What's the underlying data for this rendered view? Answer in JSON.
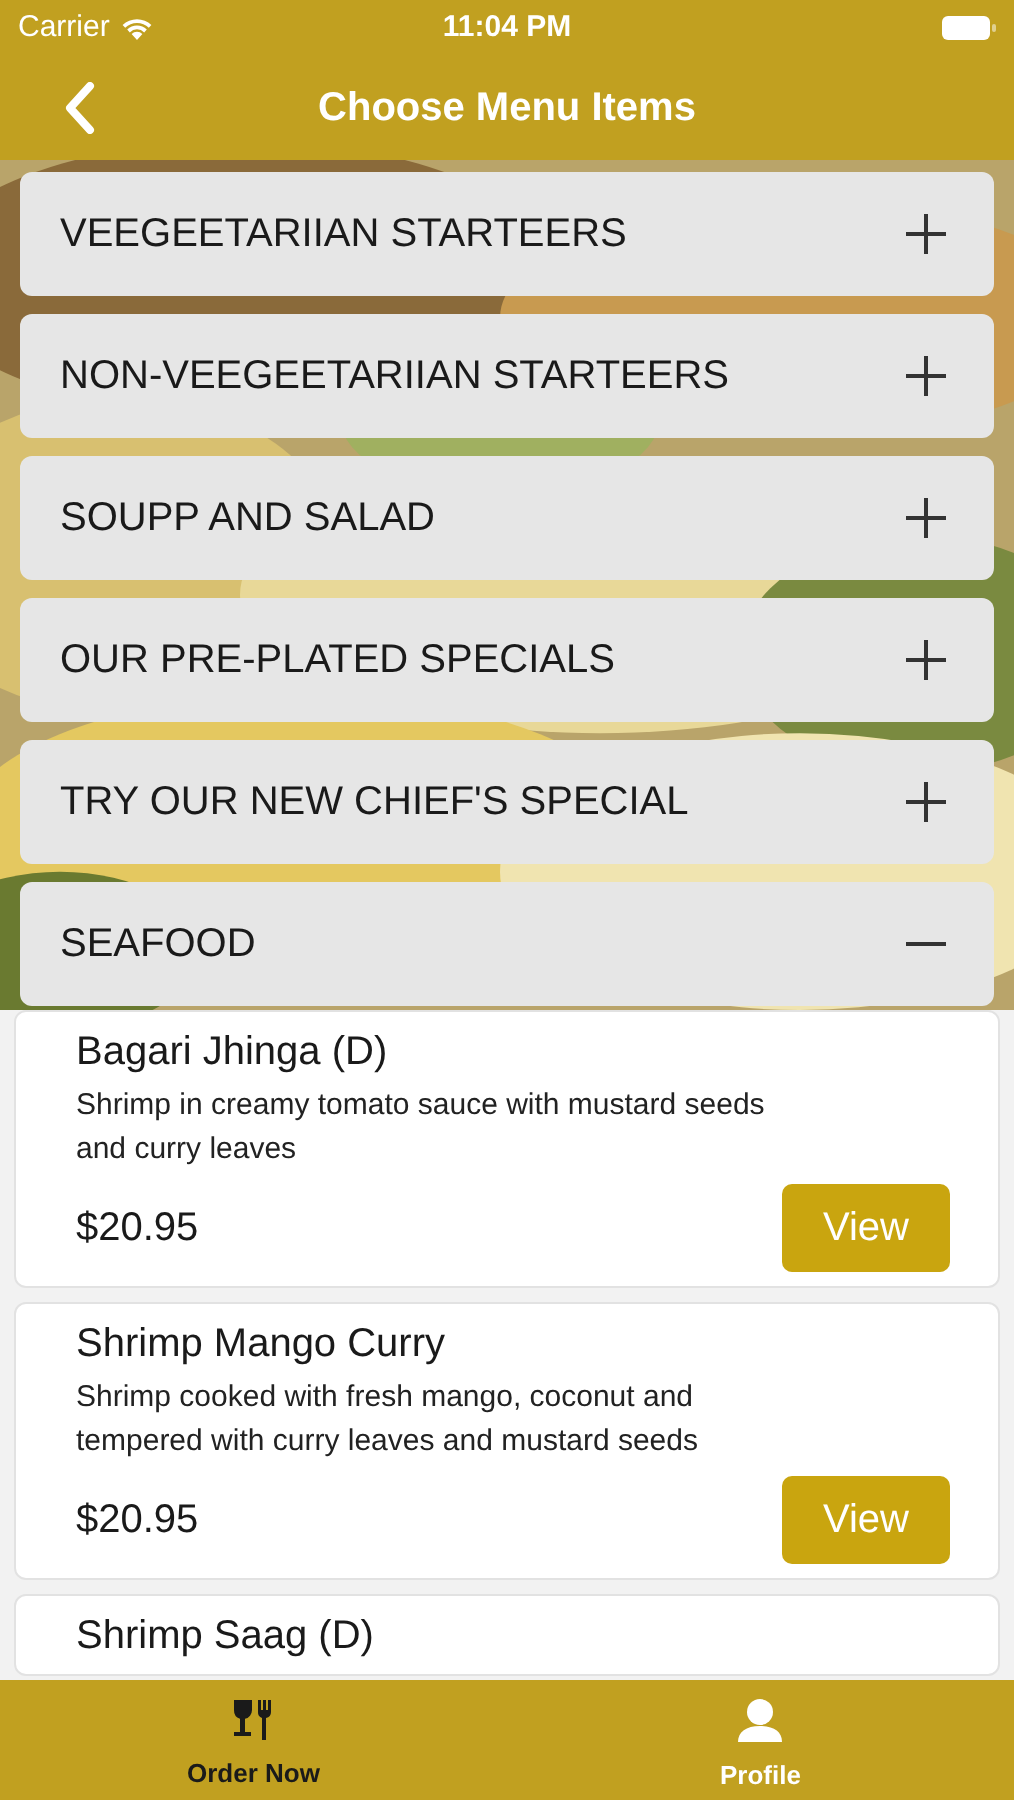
{
  "status_bar": {
    "carrier": "Carrier",
    "time": "11:04 PM"
  },
  "nav": {
    "title": "Choose Menu Items"
  },
  "categories": [
    {
      "name": "VEEGEETARIIAN STARTEERS",
      "expanded": false
    },
    {
      "name": "NON-VEEGEETARIIAN STARTEERS",
      "expanded": false
    },
    {
      "name": "SOUPP AND SALAD",
      "expanded": false
    },
    {
      "name": "OUR PRE-PLATED SPECIALS",
      "expanded": false
    },
    {
      "name": "TRY OUR NEW CHIEF'S SPECIAL",
      "expanded": false
    },
    {
      "name": "SEAFOOD",
      "expanded": true
    }
  ],
  "items": [
    {
      "name": "Bagari Jhinga (D)",
      "description": "Shrimp in creamy tomato sauce with mustard seeds and curry leaves",
      "price": "$20.95",
      "button": "View"
    },
    {
      "name": "Shrimp Mango Curry",
      "description": "Shrimp cooked with fresh mango, coconut and tempered with curry leaves and mustard seeds",
      "price": "$20.95",
      "button": "View"
    },
    {
      "name": "Shrimp Saag (D)"
    }
  ],
  "tabs": [
    {
      "label": "Order Now",
      "kind": "order",
      "selected": true
    },
    {
      "label": "Profile",
      "kind": "profile",
      "selected": false
    }
  ]
}
